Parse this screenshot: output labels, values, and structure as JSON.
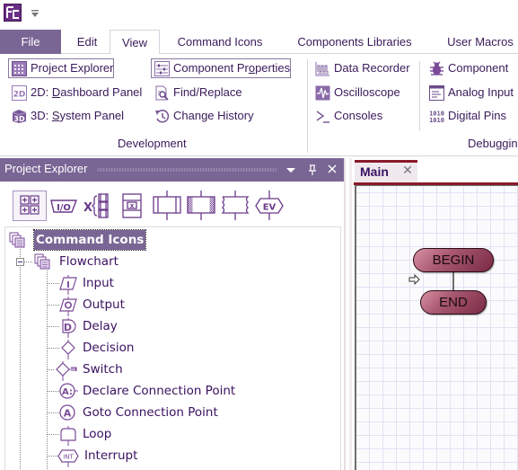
{
  "app": {
    "logo_icon": "flowcode-logo-icon",
    "quick_access_icon": "customize-quick-access-icon"
  },
  "ribbon_tabs": [
    {
      "label": "File"
    },
    {
      "label": "Edit"
    },
    {
      "label": "View",
      "active": true
    },
    {
      "label": "Command Icons"
    },
    {
      "label": "Components Libraries"
    },
    {
      "label": "User Macros"
    }
  ],
  "ribbon": {
    "development": {
      "label": "Development",
      "items": [
        {
          "label": "Project Explorer",
          "icon": "project-explorer-icon",
          "checked": true
        },
        {
          "label_pre": "2D: ",
          "label_ul": "D",
          "label_post": "ashboard Panel",
          "icon": "dashboard-2d-icon"
        },
        {
          "label_pre": "3D: ",
          "label_ul": "S",
          "label_post": "ystem Panel",
          "icon": "system-3d-icon"
        },
        {
          "label_pre": "Component Pr",
          "label_ul": "o",
          "label_post": "perties",
          "icon": "component-properties-icon",
          "checked": true
        },
        {
          "label": "Find/Replace",
          "icon": "find-replace-icon"
        },
        {
          "label": "Change History",
          "icon": "history-icon"
        }
      ]
    },
    "debugging": {
      "label": "Debuggin",
      "items": [
        {
          "label": "Data Recorder",
          "icon": "data-recorder-icon"
        },
        {
          "label": "Oscilloscope",
          "icon": "oscilloscope-icon"
        },
        {
          "label": "Consoles",
          "icon": "console-icon"
        },
        {
          "label": "Component",
          "icon": "bug-icon"
        },
        {
          "label_pre": "Analo",
          "label_ul": "g",
          "label_post": " Input",
          "icon": "analog-input-icon"
        },
        {
          "label": "Digital Pins",
          "icon": "digital-pins-icon"
        }
      ]
    }
  },
  "project_explorer": {
    "title": "Project Explorer",
    "dropdown_icon": "dropdown-icon",
    "pin_icon": "pin-icon",
    "close_icon": "close-icon",
    "toolbar": [
      {
        "name": "command-icons-view",
        "selected": true
      },
      {
        "name": "ports-view",
        "text": "I/O"
      },
      {
        "name": "globals-view",
        "text": "X"
      },
      {
        "name": "macros-view"
      },
      {
        "name": "component-macros-view"
      },
      {
        "name": "component-hatched-view"
      },
      {
        "name": "wavy-macros-view"
      },
      {
        "name": "events-view",
        "text": "EV"
      }
    ],
    "tree": {
      "root": "Command Icons",
      "folder": "Flowchart",
      "items": [
        {
          "label": "Input",
          "icon": "input-icon",
          "glyph": "I"
        },
        {
          "label": "Output",
          "icon": "output-icon",
          "glyph": "O"
        },
        {
          "label": "Delay",
          "icon": "delay-icon",
          "glyph": "D"
        },
        {
          "label": "Decision",
          "icon": "decision-icon"
        },
        {
          "label": "Switch",
          "icon": "switch-icon"
        },
        {
          "label": "Declare Connection Point",
          "icon": "declare-connection-point-icon",
          "glyph": "A:"
        },
        {
          "label": "Goto Connection Point",
          "icon": "goto-connection-point-icon",
          "glyph": "A"
        },
        {
          "label": "Loop",
          "icon": "loop-icon"
        },
        {
          "label": "Interrupt",
          "icon": "interrupt-icon",
          "glyph": "INT"
        }
      ]
    }
  },
  "document": {
    "tab_label": "Main",
    "close_glyph": "✕",
    "flowchart": {
      "begin_label": "BEGIN",
      "end_label": "END"
    }
  },
  "colors": {
    "accent_purple": "#7a6695",
    "text_purple": "#3a1a5a",
    "doc_tab_accent": "#8a1a2a",
    "terminator": "#a85870"
  }
}
